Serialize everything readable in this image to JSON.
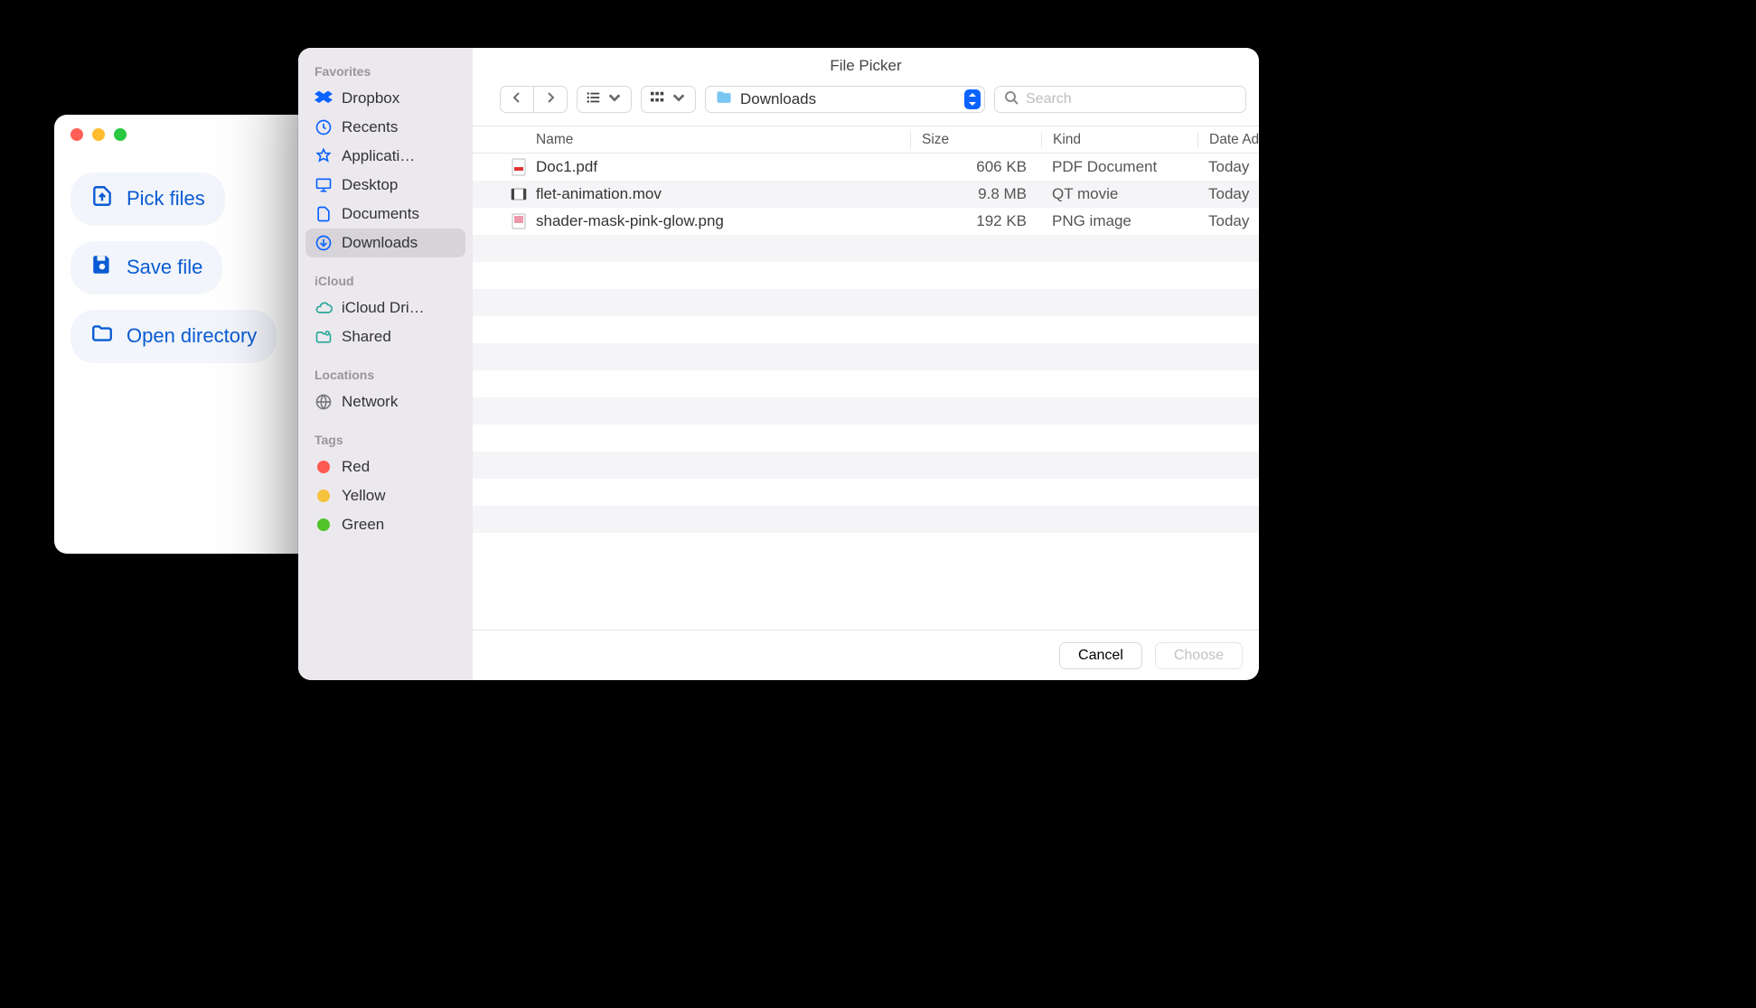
{
  "app": {
    "buttons": {
      "pick_files": "Pick files",
      "save_file": "Save file",
      "open_directory": "Open directory"
    }
  },
  "picker": {
    "title": "File Picker",
    "location": "Downloads",
    "search_placeholder": "Search",
    "columns": {
      "name": "Name",
      "size": "Size",
      "kind": "Kind",
      "date": "Date Added"
    },
    "footer": {
      "cancel": "Cancel",
      "choose": "Choose"
    },
    "sidebar": {
      "sections": [
        {
          "label": "Favorites",
          "items": [
            {
              "label": "Dropbox",
              "icon": "dropbox"
            },
            {
              "label": "Recents",
              "icon": "clock"
            },
            {
              "label": "Applicati…",
              "icon": "appstore"
            },
            {
              "label": "Desktop",
              "icon": "desktop"
            },
            {
              "label": "Documents",
              "icon": "document"
            },
            {
              "label": "Downloads",
              "icon": "download",
              "selected": true
            }
          ]
        },
        {
          "label": "iCloud",
          "items": [
            {
              "label": "iCloud Dri…",
              "icon": "cloud"
            },
            {
              "label": "Shared",
              "icon": "shared"
            }
          ]
        },
        {
          "label": "Locations",
          "items": [
            {
              "label": "Network",
              "icon": "globe"
            }
          ]
        },
        {
          "label": "Tags",
          "items": [
            {
              "label": "Red",
              "tag_color": "#ff5a52"
            },
            {
              "label": "Yellow",
              "tag_color": "#f7c23c"
            },
            {
              "label": "Green",
              "tag_color": "#53c22b"
            }
          ]
        }
      ]
    },
    "files": [
      {
        "name": "Doc1.pdf",
        "size": "606 KB",
        "kind": "PDF Document",
        "date": "Today",
        "icon": "pdf"
      },
      {
        "name": "flet-animation.mov",
        "size": "9.8 MB",
        "kind": "QT movie",
        "date": "Today",
        "icon": "mov"
      },
      {
        "name": "shader-mask-pink-glow.png",
        "size": "192 KB",
        "kind": "PNG image",
        "date": "Today",
        "icon": "png"
      }
    ]
  }
}
